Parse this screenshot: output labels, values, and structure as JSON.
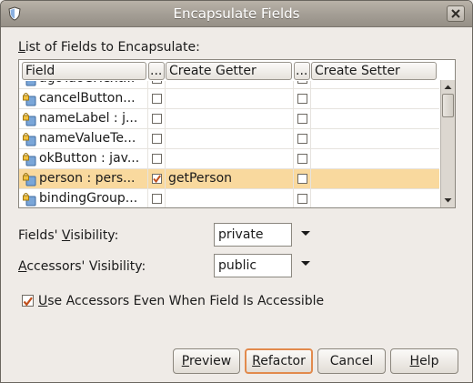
{
  "window": {
    "title": "Encapsulate Fields"
  },
  "list_label": {
    "mnemonic": "L",
    "rest": "ist of Fields to Encapsulate:"
  },
  "table": {
    "headers": {
      "field": "Field",
      "getter_check": "...",
      "getter": "Create Getter",
      "setter_check": "...",
      "setter": "Create Setter"
    },
    "rows": [
      {
        "field": "agoTaoC.Text...",
        "getter_checked": false,
        "getter": "",
        "setter_checked": false,
        "setter": "",
        "selected": false
      },
      {
        "field": "cancelButton...",
        "getter_checked": false,
        "getter": "",
        "setter_checked": false,
        "setter": "",
        "selected": false
      },
      {
        "field": "nameLabel : j...",
        "getter_checked": false,
        "getter": "",
        "setter_checked": false,
        "setter": "",
        "selected": false
      },
      {
        "field": "nameValueTe...",
        "getter_checked": false,
        "getter": "",
        "setter_checked": false,
        "setter": "",
        "selected": false
      },
      {
        "field": "okButton : jav...",
        "getter_checked": false,
        "getter": "",
        "setter_checked": false,
        "setter": "",
        "selected": false
      },
      {
        "field": "person : pers...",
        "getter_checked": true,
        "getter": "getPerson",
        "setter_checked": false,
        "setter": "",
        "selected": true
      },
      {
        "field": "bindingGroup...",
        "getter_checked": false,
        "getter": "",
        "setter_checked": false,
        "setter": "",
        "selected": false
      }
    ]
  },
  "fields_visibility": {
    "label_pre": "Fields' ",
    "label_mnemonic": "V",
    "label_post": "isibility:",
    "value": "private"
  },
  "accessors_visibility": {
    "label_mnemonic": "A",
    "label_post": "ccessors' Visibility:",
    "value": "public"
  },
  "use_accessors": {
    "mnemonic": "U",
    "rest": "se Accessors Even When Field Is Accessible",
    "checked": true
  },
  "buttons": {
    "preview": {
      "mnemonic": "P",
      "rest": "review"
    },
    "refactor": {
      "mnemonic": "R",
      "rest": "efactor"
    },
    "cancel": {
      "label": "Cancel"
    },
    "help": {
      "mnemonic": "H",
      "rest": "elp"
    }
  },
  "colors": {
    "selected_row": "#f9d99e",
    "check_mark": "#c0501e",
    "default_button_border": "#e28a4c"
  }
}
